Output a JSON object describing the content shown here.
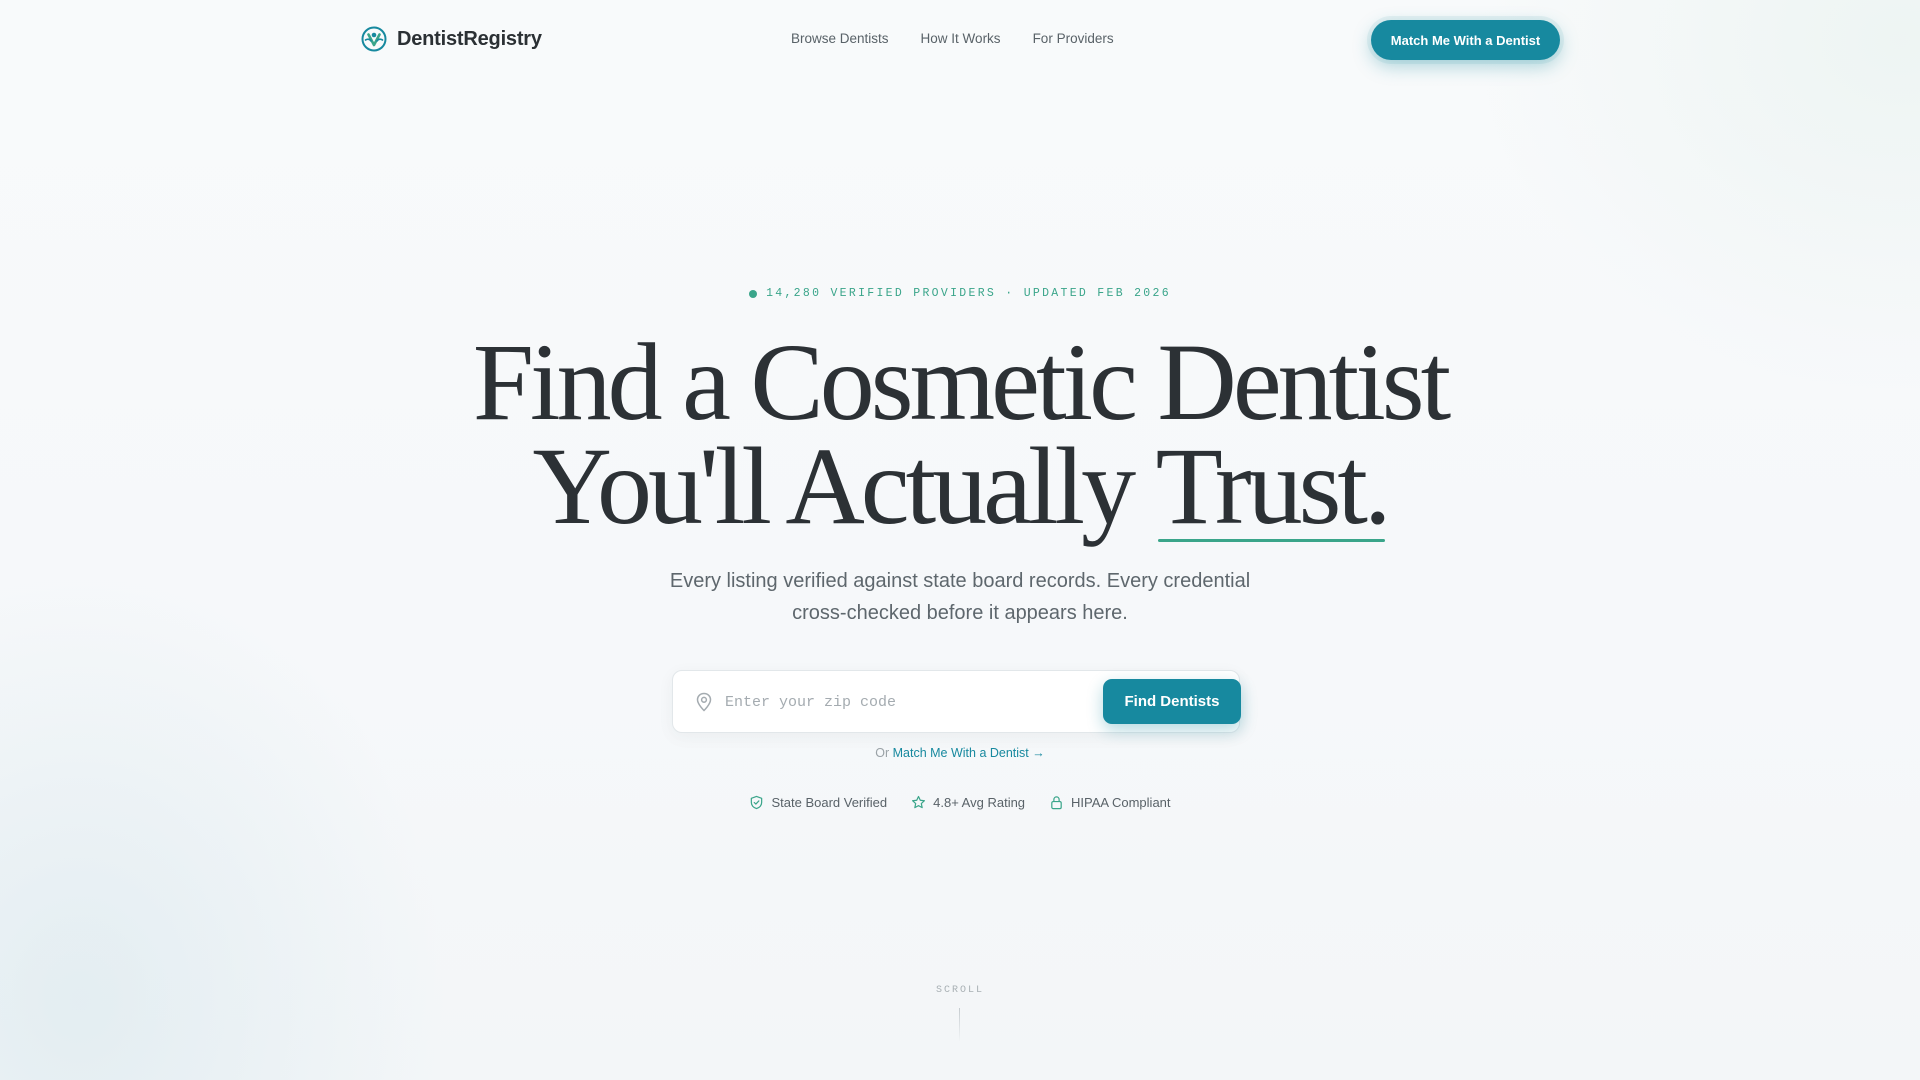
{
  "nav": {
    "brand": "DentistRegistry",
    "links": [
      "Browse Dentists",
      "How It Works",
      "For Providers"
    ],
    "cta": "Match Me With a Dentist"
  },
  "hero": {
    "eyebrow": "14,280 VERIFIED PROVIDERS · UPDATED FEB 2026",
    "headline_line1": "Find a Cosmetic Dentist",
    "headline_line2_lead": "You'll Actually ",
    "headline_line2_accent": "Trust.",
    "subhead": "Every listing verified against state board records. Every credential cross-checked before it appears here."
  },
  "search": {
    "placeholder": "Enter your zip code",
    "value": "",
    "button": "Find Dentists"
  },
  "alternate": {
    "prefix": "Or",
    "link": "Match Me With a Dentist →"
  },
  "trust_badges": [
    {
      "icon": "shield-check-icon",
      "label": "State Board Verified"
    },
    {
      "icon": "star-icon",
      "label": "4.8+ Avg Rating"
    },
    {
      "icon": "lock-icon",
      "label": "HIPAA Compliant"
    }
  ],
  "scroll": {
    "label": "SCROLL"
  },
  "colors": {
    "primary": "#17899f",
    "accent": "#3aa58a",
    "text": "#2c3135",
    "muted": "#5e676d"
  }
}
